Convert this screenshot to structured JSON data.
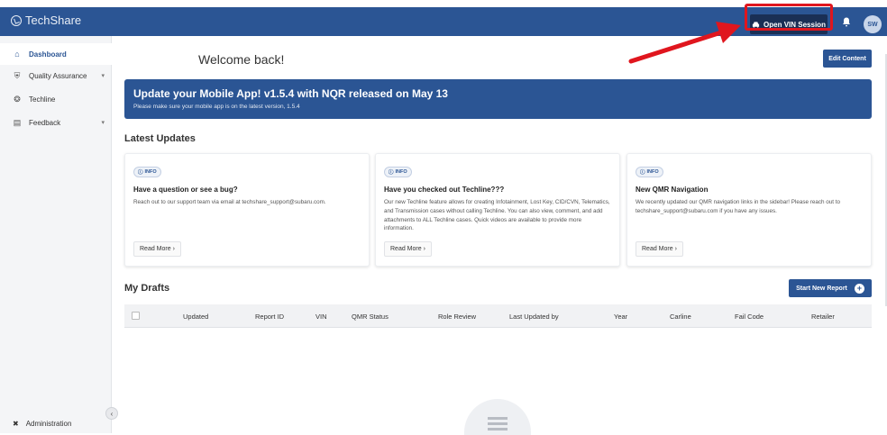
{
  "app": {
    "logo_text": "TechShare",
    "open_vin_label": "Open VIN Session",
    "avatar_initials": "SW",
    "header_color": "#2b5594",
    "highlight_color": "#e0161e"
  },
  "sidebar": {
    "items": [
      {
        "label": "Dashboard",
        "icon": "home-icon",
        "active": true
      },
      {
        "label": "Quality Assurance",
        "icon": "car-icon",
        "has_children": true
      },
      {
        "label": "Techline",
        "icon": "wheel-icon"
      },
      {
        "label": "Feedback",
        "icon": "feedback-icon",
        "has_children": true
      }
    ],
    "admin_label": "Administration"
  },
  "main": {
    "welcome": "Welcome back!",
    "edit_label": "Edit Content",
    "banner": {
      "title": "Update your Mobile App! v1.5.4 with NQR released on May 13",
      "subtitle": "Please make sure your mobile app is on the latest version, 1.5.4"
    },
    "latest_updates_title": "Latest Updates",
    "cards": [
      {
        "badge": "INFO",
        "title": "Have a question or see a bug?",
        "body": "Reach out to our support team via email at techshare_support@subaru.com.",
        "read_more": "Read More"
      },
      {
        "badge": "INFO",
        "title": "Have you checked out Techline???",
        "body": "Our new Techline feature allows for creating Infotainment, Lost Key, CID/CVN, Telematics, and Transmission cases without calling Techline. You can also view, comment, and add attachments to ALL Techline cases. Quick videos are available to provide more information.",
        "read_more": "Read More"
      },
      {
        "badge": "INFO",
        "title": "New QMR Navigation",
        "body": "We recently updated our QMR navigation links in the sidebar! Please reach out to techshare_support@subaru.com if you have any issues.",
        "read_more": "Read More"
      }
    ],
    "drafts_title": "My Drafts",
    "start_new_label": "Start New Report",
    "table_headers": [
      "Updated",
      "Report ID",
      "VIN",
      "QMR Status",
      "Role Review",
      "Last Updated by",
      "Year",
      "Carline",
      "Fail Code",
      "Retailer"
    ]
  }
}
